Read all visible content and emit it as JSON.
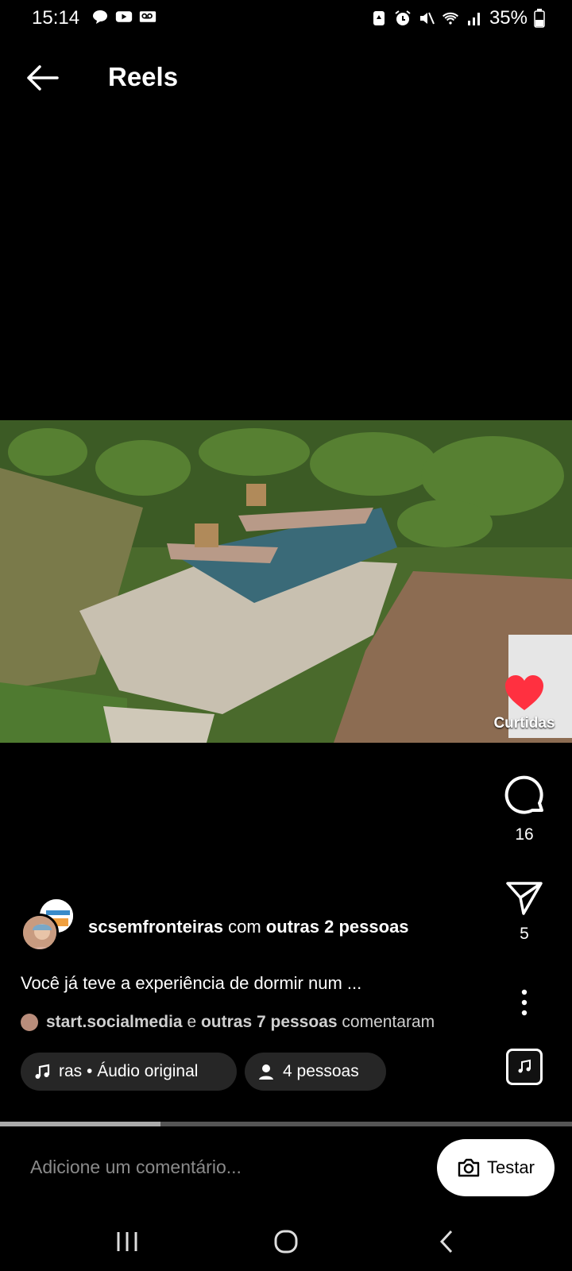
{
  "status_bar": {
    "time": "15:14",
    "battery": "35%",
    "left_icons": [
      "chat-bubble-icon",
      "youtube-icon",
      "voicemail-icon"
    ],
    "right_icons": [
      "battery-saver-icon",
      "alarm-icon",
      "mute-icon",
      "wifi-icon",
      "signal-icon",
      "battery-icon"
    ]
  },
  "header": {
    "title": "Reels"
  },
  "reel": {
    "liked": true,
    "like_label": "Curtidas",
    "comments_count": "16",
    "shares_count": "5",
    "author_username": "scsemfronteiras",
    "author_with": "com",
    "author_others": "outras 2 pessoas",
    "caption": "Você já teve a experiência de dormir num ...",
    "commenters_first": "start.socialmedia",
    "commenters_connector": "e",
    "commenters_others": "outras 7 pessoas",
    "commenters_suffix": "comentaram",
    "audio_label": "ras • Áudio original",
    "people_label": "4 pessoas",
    "progress": 0.28
  },
  "comment_bar": {
    "placeholder": "Adicione um comentário...",
    "testar_label": "Testar"
  },
  "colors": {
    "like": "#ff3040",
    "pill": "#262626"
  }
}
